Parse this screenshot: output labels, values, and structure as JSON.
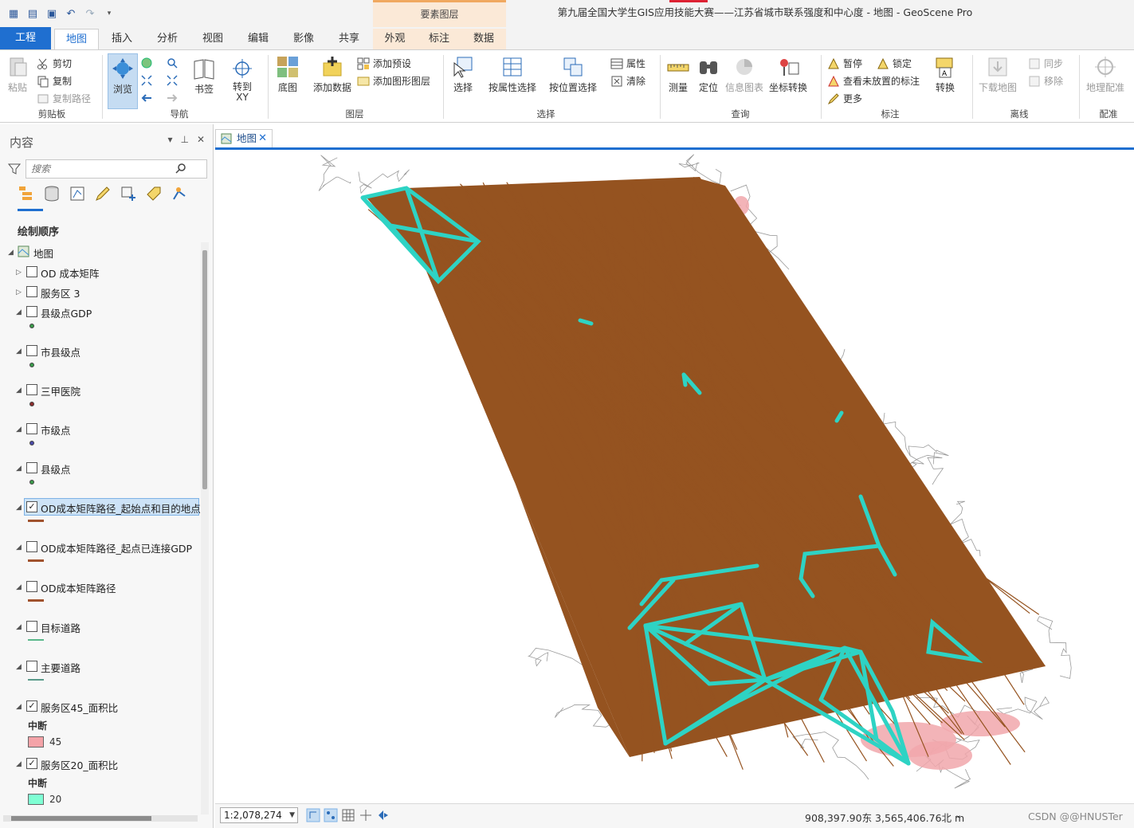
{
  "app": {
    "window_title": "第九届全国大学生GIS应用技能大赛——江苏省城市联系强度和中心度 - 地图 - GeoScene Pro",
    "context_group": "要素图层"
  },
  "tabs": [
    "工程",
    "地图",
    "插入",
    "分析",
    "视图",
    "编辑",
    "影像",
    "共享",
    "外观",
    "标注",
    "数据"
  ],
  "ribbon": {
    "clipboard": {
      "paste": "粘贴",
      "cut": "剪切",
      "copy": "复制",
      "copy_path": "复制路径",
      "label": "剪贴板"
    },
    "navigate": {
      "browse": "浏览",
      "bookmarks": "书签",
      "goto_xy_1": "转到",
      "goto_xy_2": "XY",
      "label": "导航"
    },
    "layer": {
      "basemap": "底图",
      "add_data": "添加数据",
      "add_preset": "添加预设",
      "add_graphics_layer": "添加图形图层",
      "label": "图层"
    },
    "selection": {
      "select": "选择",
      "select_by_attr": "按属性选择",
      "select_by_loc": "按位置选择",
      "attributes": "属性",
      "clear": "清除",
      "label": "选择"
    },
    "inquiry": {
      "measure": "测量",
      "locate": "定位",
      "infographics": "信息图表",
      "coord_convert": "坐标转换",
      "label": "查询"
    },
    "labeling": {
      "pause": "暂停",
      "lock": "锁定",
      "view_unplaced": "查看未放置的标注",
      "more": "更多",
      "convert": "转换",
      "label": "标注"
    },
    "offline": {
      "download_map": "下载地图",
      "sync": "同步",
      "remove": "移除",
      "label": "离线"
    },
    "georef": {
      "georeference": "地理配准",
      "label": "配准"
    }
  },
  "contents": {
    "title": "内容",
    "search_placeholder": "搜索",
    "draw_order": "绘制顺序",
    "map_node": "地图",
    "layers": [
      {
        "name": "OD 成本矩阵",
        "checked": false,
        "expand": "▷",
        "symbol": "none"
      },
      {
        "name": "服务区 3",
        "checked": false,
        "expand": "▷",
        "symbol": "none"
      },
      {
        "name": "县级点GDP",
        "checked": false,
        "expand": "◢",
        "symbol": "dot",
        "color": "#3a9a4a"
      },
      {
        "name": "市县级点",
        "checked": false,
        "expand": "◢",
        "symbol": "dot",
        "color": "#3a9a4a"
      },
      {
        "name": "三甲医院",
        "checked": false,
        "expand": "◢",
        "symbol": "dot",
        "color": "#8b2a2a"
      },
      {
        "name": "市级点",
        "checked": false,
        "expand": "◢",
        "symbol": "dot",
        "color": "#4a4aa8"
      },
      {
        "name": "县级点",
        "checked": false,
        "expand": "◢",
        "symbol": "dot",
        "color": "#3a9a4a"
      },
      {
        "name": "OD成本矩阵路径_起始点和目的地点均为GDP",
        "checked": true,
        "expand": "◢",
        "symbol": "line",
        "color": "#a0522d",
        "selected": true
      },
      {
        "name": "OD成本矩阵路径_起点已连接GDP",
        "checked": false,
        "expand": "◢",
        "symbol": "line",
        "color": "#a0522d"
      },
      {
        "name": "OD成本矩阵路径",
        "checked": false,
        "expand": "◢",
        "symbol": "line",
        "color": "#a0522d"
      },
      {
        "name": "目标道路",
        "checked": false,
        "expand": "◢",
        "symbol": "line",
        "color": "#5ab88a"
      },
      {
        "name": "主要道路",
        "checked": false,
        "expand": "◢",
        "symbol": "line",
        "color": "#5a9a8a"
      },
      {
        "name": "服务区45_面积比",
        "checked": true,
        "expand": "◢",
        "symbol": "patch",
        "legend_head": "中断",
        "legend_value": "45",
        "color": "#f4a3a8"
      },
      {
        "name": "服务区20_面积比",
        "checked": true,
        "expand": "◢",
        "symbol": "patch",
        "legend_head": "中断",
        "legend_value": "20",
        "color": "#7fffd4"
      }
    ]
  },
  "map": {
    "tab_label": "地图",
    "colors": {
      "od_lines": "#955320",
      "service_lines": "#2ed3c4",
      "roads": "#9a9a9a",
      "service_area": "#f1a7ab"
    }
  },
  "status": {
    "scale": "1:2,078,274",
    "coordinates": "908,397.90东 3,565,406.76北 m",
    "watermark": "CSDN @@HNUSTer"
  }
}
